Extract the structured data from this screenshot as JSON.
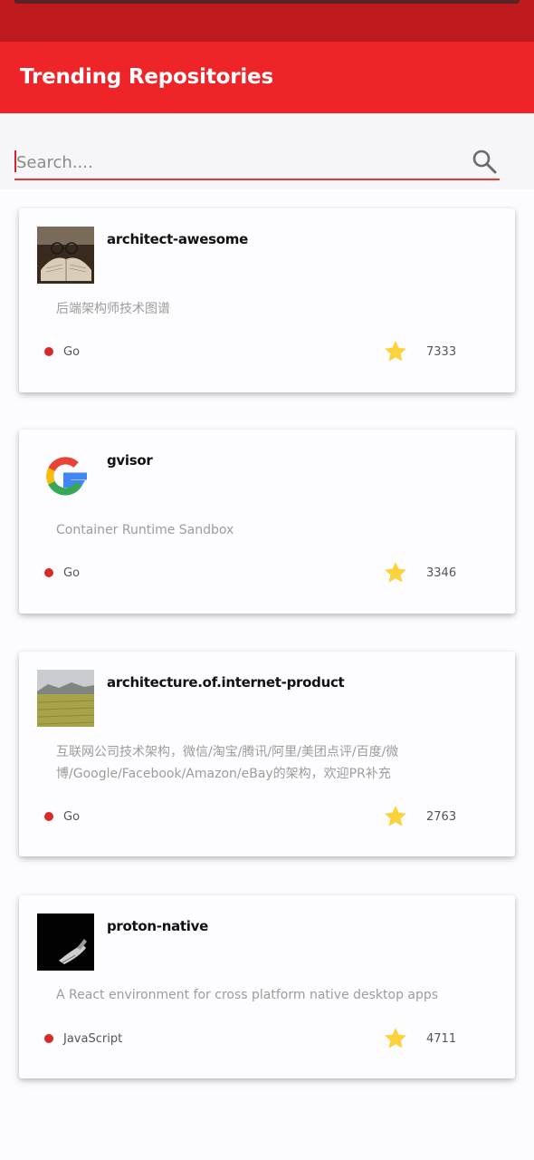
{
  "app": {
    "title": "Trending Repositories",
    "accent_color": "#ee2429",
    "status_bar_color": "#bf1b1f"
  },
  "search": {
    "placeholder": "Search....",
    "value": "",
    "icon": "search-icon"
  },
  "repos": [
    {
      "name": "architect-awesome",
      "description": "后端架构师技术图谱",
      "language": "Go",
      "language_color": "#d82a2a",
      "stars": "7333",
      "avatar": "book-with-glasses-photo"
    },
    {
      "name": "gvisor",
      "description": "Container Runtime Sandbox",
      "language": "Go",
      "language_color": "#d82a2a",
      "stars": "3346",
      "avatar": "google-logo"
    },
    {
      "name": "architecture.of.internet-product",
      "description": "互联网公司技术架构，微信/淘宝/腾讯/阿里/美团点评/百度/微博/Google/Facebook/Amazon/eBay的架构，欢迎PR补充",
      "language": "Go",
      "language_color": "#d82a2a",
      "stars": "2763",
      "avatar": "field-landscape-photo"
    },
    {
      "name": "proton-native",
      "description": "A React environment for cross platform native desktop apps",
      "language": "JavaScript",
      "language_color": "#d82a2a",
      "stars": "4711",
      "avatar": "dark-hand-photo"
    }
  ]
}
